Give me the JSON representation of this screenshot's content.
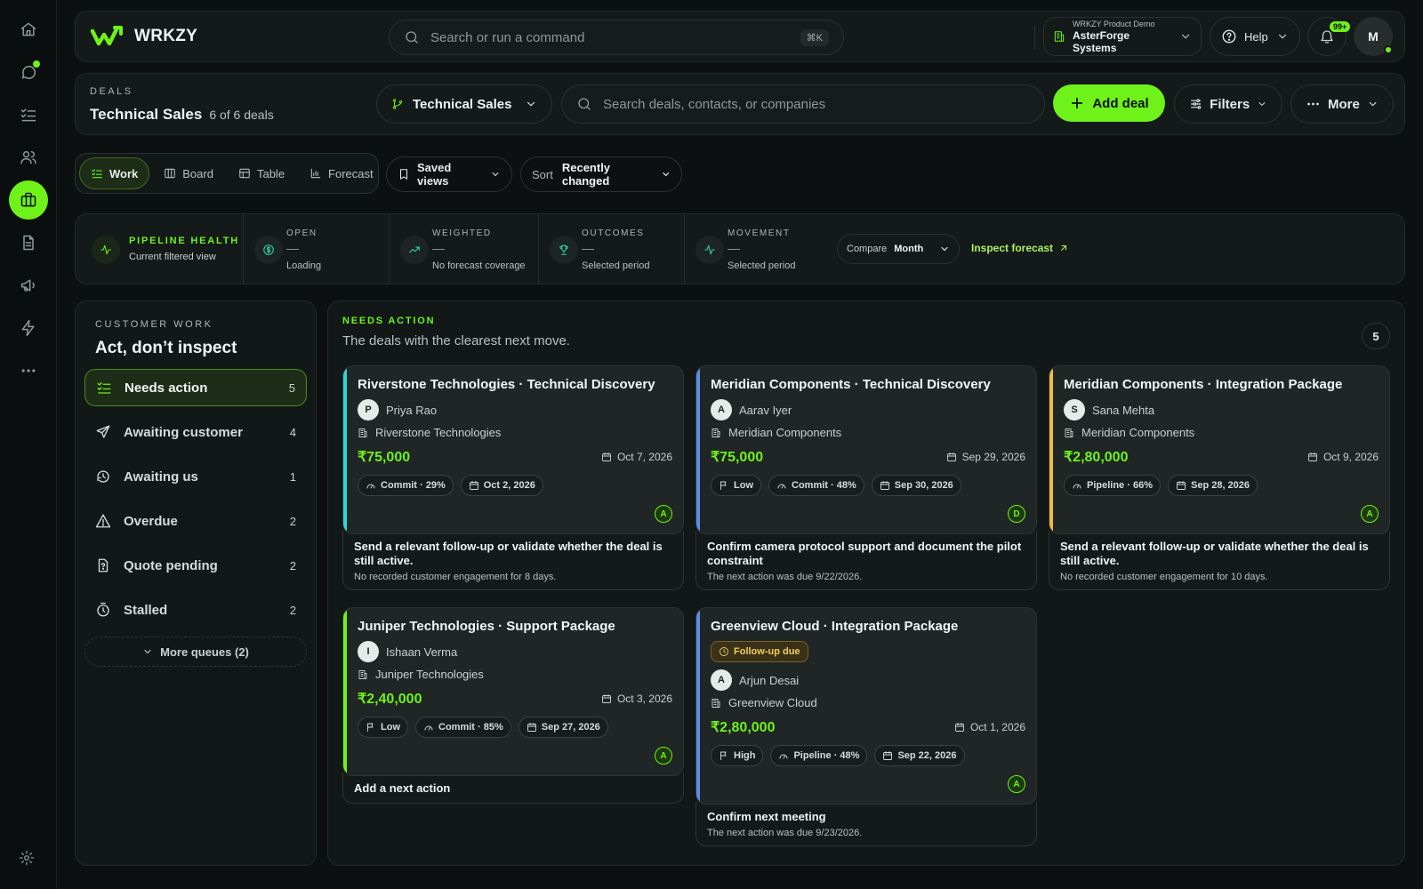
{
  "brand": {
    "name": "WRKZY",
    "accent": "#6ef21a"
  },
  "command": {
    "placeholder": "Search or run a command",
    "shortcut": "⌘K"
  },
  "workspace": {
    "label": "WRKZY Product Demo",
    "name": "AsterForge Systems"
  },
  "help": {
    "label": "Help"
  },
  "notifications": {
    "count": "99+"
  },
  "user": {
    "initial": "M"
  },
  "deals": {
    "eyebrow": "DEALS",
    "title": "Technical Sales",
    "count_text": "6 of 6 deals",
    "pipeline": "Technical Sales",
    "search_placeholder": "Search deals, contacts, or companies",
    "add_label": "Add deal",
    "filters_label": "Filters",
    "more_label": "More"
  },
  "views": {
    "tabs": [
      "Work",
      "Board",
      "Table",
      "Forecast"
    ],
    "saved_label": "Saved views",
    "sort_label": "Sort",
    "sort_value": "Recently changed"
  },
  "health": {
    "eyebrow": "PIPELINE HEALTH",
    "sub": "Current filtered view",
    "metrics": [
      {
        "label": "OPEN",
        "value": "—",
        "sub": "Loading"
      },
      {
        "label": "WEIGHTED",
        "value": "—",
        "sub": "No forecast coverage"
      },
      {
        "label": "OUTCOMES",
        "value": "—",
        "sub": "Selected period"
      },
      {
        "label": "MOVEMENT",
        "value": "—",
        "sub": "Selected period"
      }
    ],
    "compare_label": "Compare",
    "compare_value": "Month",
    "inspect_label": "Inspect forecast"
  },
  "queues": {
    "eyebrow": "CUSTOMER WORK",
    "title": "Act, don’t inspect",
    "items": [
      {
        "label": "Needs action",
        "count": "5"
      },
      {
        "label": "Awaiting customer",
        "count": "4"
      },
      {
        "label": "Awaiting us",
        "count": "1"
      },
      {
        "label": "Overdue",
        "count": "2"
      },
      {
        "label": "Quote pending",
        "count": "2"
      },
      {
        "label": "Stalled",
        "count": "2"
      }
    ],
    "more_label": "More queues (2)"
  },
  "main": {
    "eyebrow": "NEEDS ACTION",
    "subtitle": "The deals with the clearest next move.",
    "count": "5",
    "cards": [
      {
        "title": "Riverstone Technologies · Technical Discovery",
        "contact_initial": "P",
        "contact": "Priya Rao",
        "company": "Riverstone Technologies",
        "amount": "₹75,000",
        "close_date": "Oct 7, 2026",
        "chips": [
          "Commit · 29%",
          "Oct 2, 2026"
        ],
        "owner": "A",
        "stripe": "#2fd6d6",
        "next_title": "Send a relevant follow-up or validate whether the deal is still active.",
        "next_sub": "No recorded customer engagement for 8 days."
      },
      {
        "title": "Meridian Components · Technical Discovery",
        "contact_initial": "A",
        "contact": "Aarav Iyer",
        "company": "Meridian Components",
        "amount": "₹75,000",
        "close_date": "Sep 29, 2026",
        "chips": [
          "Low",
          "Commit · 48%",
          "Sep 30, 2026"
        ],
        "owner": "D",
        "stripe": "#5b8fe6",
        "next_title": "Confirm camera protocol support and document the pilot constraint",
        "next_sub": "The next action was due 9/22/2026."
      },
      {
        "title": "Meridian Components · Integration Package",
        "contact_initial": "S",
        "contact": "Sana Mehta",
        "company": "Meridian Components",
        "amount": "₹2,80,000",
        "close_date": "Oct 9, 2026",
        "chips": [
          "Pipeline · 66%",
          "Sep 28, 2026"
        ],
        "owner": "A",
        "stripe": "#f2b84b",
        "next_title": "Send a relevant follow-up or validate whether the deal is still active.",
        "next_sub": "No recorded customer engagement for 10 days."
      },
      {
        "title": "Juniper Technologies · Support Package",
        "contact_initial": "I",
        "contact": "Ishaan Verma",
        "company": "Juniper Technologies",
        "amount": "₹2,40,000",
        "close_date": "Oct 3, 2026",
        "chips": [
          "Low",
          "Commit · 85%",
          "Sep 27, 2026"
        ],
        "owner": "A",
        "stripe": "#6ef21a",
        "next_title": "Add a next action",
        "next_sub": ""
      },
      {
        "title": "Greenview Cloud · Integration Package",
        "status": "Follow-up due",
        "contact_initial": "A",
        "contact": "Arjun Desai",
        "company": "Greenview Cloud",
        "amount": "₹2,80,000",
        "close_date": "Oct 1, 2026",
        "chips": [
          "High",
          "Pipeline · 48%",
          "Sep 22, 2026"
        ],
        "owner": "A",
        "stripe": "#5b8fe6",
        "next_title": "Confirm next meeting",
        "next_sub": "The next action was due 9/23/2026."
      }
    ]
  }
}
